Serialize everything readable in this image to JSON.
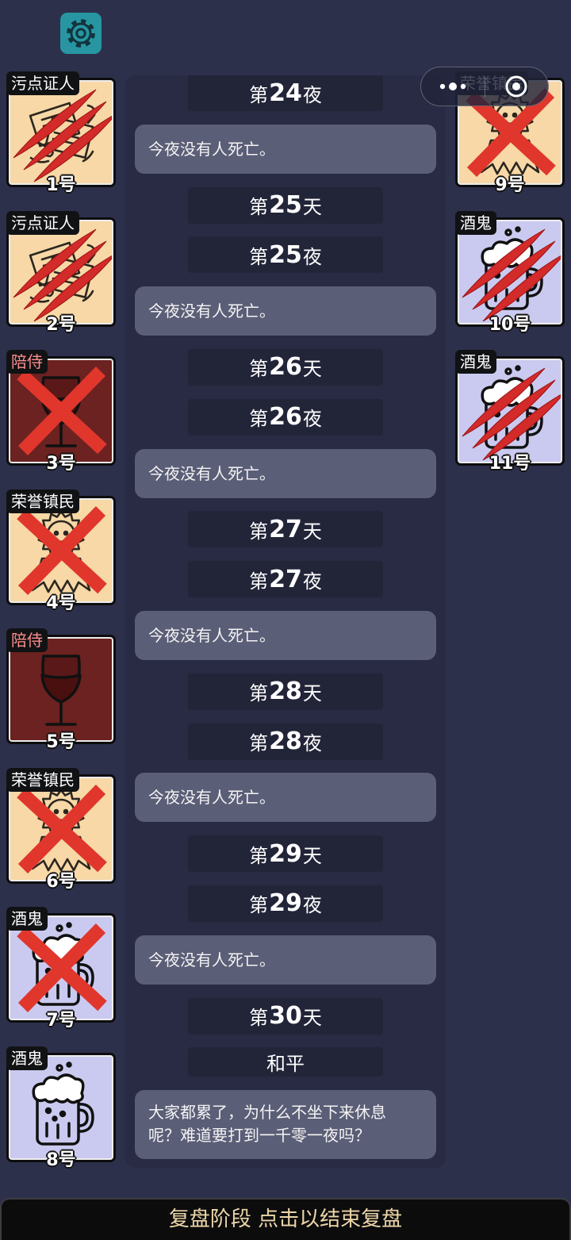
{
  "settings_button": {
    "icon": "gear-icon"
  },
  "capsule": {
    "menu_icon": "more-dots-icon",
    "close_icon": "target-circle-icon"
  },
  "players": {
    "left": [
      {
        "label": "污点证人",
        "number": "1号",
        "icon": "witness-icon",
        "mark": "claw-marks-icon"
      },
      {
        "label": "污点证人",
        "number": "2号",
        "icon": "witness-icon",
        "mark": "claw-marks-icon"
      },
      {
        "label": "陪侍",
        "number": "3号",
        "icon": "wine-glass-icon",
        "mark": "x-mark-icon"
      },
      {
        "label": "荣誉镇民",
        "number": "4号",
        "icon": "townsfolk-badge-icon",
        "mark": "x-mark-icon"
      },
      {
        "label": "陪侍",
        "number": "5号",
        "icon": "wine-glass-icon",
        "mark": null
      },
      {
        "label": "荣誉镇民",
        "number": "6号",
        "icon": "townsfolk-badge-icon",
        "mark": "x-mark-icon"
      },
      {
        "label": "酒鬼",
        "number": "7号",
        "icon": "beer-mug-icon",
        "mark": "x-mark-icon"
      },
      {
        "label": "酒鬼",
        "number": "8号",
        "icon": "beer-mug-icon",
        "mark": null
      }
    ],
    "right": [
      {
        "label": "荣誉镇民",
        "number": "9号",
        "icon": "townsfolk-badge-icon",
        "mark": "x-mark-icon"
      },
      {
        "label": "酒鬼",
        "number": "10号",
        "icon": "beer-mug-icon",
        "mark": "claw-marks-icon"
      },
      {
        "label": "酒鬼",
        "number": "11号",
        "icon": "beer-mug-icon",
        "mark": "claw-marks-icon"
      }
    ]
  },
  "log": [
    {
      "pill": {
        "pre": "第",
        "num": "24",
        "post": "夜"
      }
    },
    {
      "message": "今夜没有人死亡。"
    },
    {
      "pill": {
        "pre": "第",
        "num": "25",
        "post": "天"
      }
    },
    {
      "pill": {
        "pre": "第",
        "num": "25",
        "post": "夜"
      }
    },
    {
      "message": "今夜没有人死亡。"
    },
    {
      "pill": {
        "pre": "第",
        "num": "26",
        "post": "天"
      }
    },
    {
      "pill": {
        "pre": "第",
        "num": "26",
        "post": "夜"
      }
    },
    {
      "message": "今夜没有人死亡。"
    },
    {
      "pill": {
        "pre": "第",
        "num": "27",
        "post": "天"
      }
    },
    {
      "pill": {
        "pre": "第",
        "num": "27",
        "post": "夜"
      }
    },
    {
      "message": "今夜没有人死亡。"
    },
    {
      "pill": {
        "pre": "第",
        "num": "28",
        "post": "天"
      }
    },
    {
      "pill": {
        "pre": "第",
        "num": "28",
        "post": "夜"
      }
    },
    {
      "message": "今夜没有人死亡。"
    },
    {
      "pill": {
        "pre": "第",
        "num": "29",
        "post": "天"
      }
    },
    {
      "pill": {
        "pre": "第",
        "num": "29",
        "post": "夜"
      }
    },
    {
      "message": "今夜没有人死亡。"
    },
    {
      "pill": {
        "pre": "第",
        "num": "30",
        "post": "天"
      }
    },
    {
      "badge": "和平"
    },
    {
      "message": "大家都累了，为什么不坐下来休息呢？难道要打到一千零一夜吗？"
    }
  ],
  "footer": {
    "label": "复盘阶段 点击以结束复盘"
  },
  "colors": {
    "card_bg": {
      "witness-icon": "#f7d8a6",
      "townsfolk-badge-icon": "#f7d8a6",
      "wine-glass-icon": "#6b2220",
      "beer-mug-icon": "#cacaf0"
    },
    "label_text": {
      "wine-glass-icon": "#ff8e8e"
    },
    "death_mark": "#e0362c",
    "settings_bg": "#2796a2",
    "footer_text": "#ecd6a8"
  }
}
